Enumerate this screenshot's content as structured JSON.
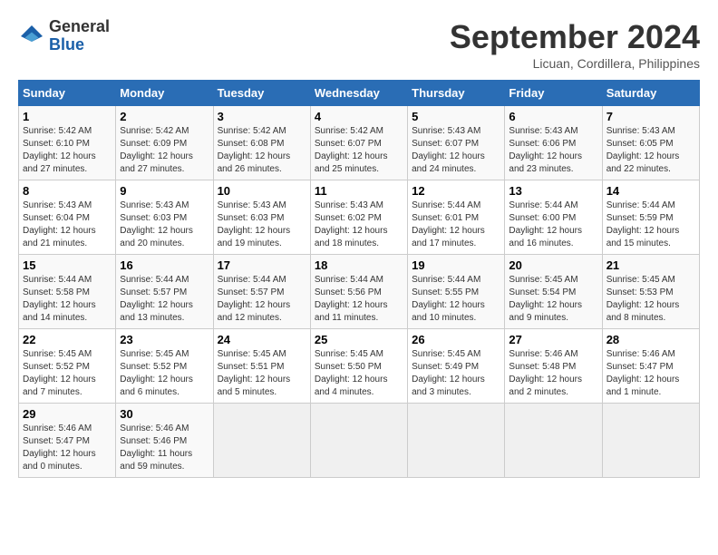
{
  "header": {
    "logo_line1": "General",
    "logo_line2": "Blue",
    "month": "September 2024",
    "location": "Licuan, Cordillera, Philippines"
  },
  "columns": [
    "Sunday",
    "Monday",
    "Tuesday",
    "Wednesday",
    "Thursday",
    "Friday",
    "Saturday"
  ],
  "weeks": [
    [
      {
        "day": "1",
        "info": "Sunrise: 5:42 AM\nSunset: 6:10 PM\nDaylight: 12 hours\nand 27 minutes."
      },
      {
        "day": "2",
        "info": "Sunrise: 5:42 AM\nSunset: 6:09 PM\nDaylight: 12 hours\nand 27 minutes."
      },
      {
        "day": "3",
        "info": "Sunrise: 5:42 AM\nSunset: 6:08 PM\nDaylight: 12 hours\nand 26 minutes."
      },
      {
        "day": "4",
        "info": "Sunrise: 5:42 AM\nSunset: 6:07 PM\nDaylight: 12 hours\nand 25 minutes."
      },
      {
        "day": "5",
        "info": "Sunrise: 5:43 AM\nSunset: 6:07 PM\nDaylight: 12 hours\nand 24 minutes."
      },
      {
        "day": "6",
        "info": "Sunrise: 5:43 AM\nSunset: 6:06 PM\nDaylight: 12 hours\nand 23 minutes."
      },
      {
        "day": "7",
        "info": "Sunrise: 5:43 AM\nSunset: 6:05 PM\nDaylight: 12 hours\nand 22 minutes."
      }
    ],
    [
      {
        "day": "8",
        "info": "Sunrise: 5:43 AM\nSunset: 6:04 PM\nDaylight: 12 hours\nand 21 minutes."
      },
      {
        "day": "9",
        "info": "Sunrise: 5:43 AM\nSunset: 6:03 PM\nDaylight: 12 hours\nand 20 minutes."
      },
      {
        "day": "10",
        "info": "Sunrise: 5:43 AM\nSunset: 6:03 PM\nDaylight: 12 hours\nand 19 minutes."
      },
      {
        "day": "11",
        "info": "Sunrise: 5:43 AM\nSunset: 6:02 PM\nDaylight: 12 hours\nand 18 minutes."
      },
      {
        "day": "12",
        "info": "Sunrise: 5:44 AM\nSunset: 6:01 PM\nDaylight: 12 hours\nand 17 minutes."
      },
      {
        "day": "13",
        "info": "Sunrise: 5:44 AM\nSunset: 6:00 PM\nDaylight: 12 hours\nand 16 minutes."
      },
      {
        "day": "14",
        "info": "Sunrise: 5:44 AM\nSunset: 5:59 PM\nDaylight: 12 hours\nand 15 minutes."
      }
    ],
    [
      {
        "day": "15",
        "info": "Sunrise: 5:44 AM\nSunset: 5:58 PM\nDaylight: 12 hours\nand 14 minutes."
      },
      {
        "day": "16",
        "info": "Sunrise: 5:44 AM\nSunset: 5:57 PM\nDaylight: 12 hours\nand 13 minutes."
      },
      {
        "day": "17",
        "info": "Sunrise: 5:44 AM\nSunset: 5:57 PM\nDaylight: 12 hours\nand 12 minutes."
      },
      {
        "day": "18",
        "info": "Sunrise: 5:44 AM\nSunset: 5:56 PM\nDaylight: 12 hours\nand 11 minutes."
      },
      {
        "day": "19",
        "info": "Sunrise: 5:44 AM\nSunset: 5:55 PM\nDaylight: 12 hours\nand 10 minutes."
      },
      {
        "day": "20",
        "info": "Sunrise: 5:45 AM\nSunset: 5:54 PM\nDaylight: 12 hours\nand 9 minutes."
      },
      {
        "day": "21",
        "info": "Sunrise: 5:45 AM\nSunset: 5:53 PM\nDaylight: 12 hours\nand 8 minutes."
      }
    ],
    [
      {
        "day": "22",
        "info": "Sunrise: 5:45 AM\nSunset: 5:52 PM\nDaylight: 12 hours\nand 7 minutes."
      },
      {
        "day": "23",
        "info": "Sunrise: 5:45 AM\nSunset: 5:52 PM\nDaylight: 12 hours\nand 6 minutes."
      },
      {
        "day": "24",
        "info": "Sunrise: 5:45 AM\nSunset: 5:51 PM\nDaylight: 12 hours\nand 5 minutes."
      },
      {
        "day": "25",
        "info": "Sunrise: 5:45 AM\nSunset: 5:50 PM\nDaylight: 12 hours\nand 4 minutes."
      },
      {
        "day": "26",
        "info": "Sunrise: 5:45 AM\nSunset: 5:49 PM\nDaylight: 12 hours\nand 3 minutes."
      },
      {
        "day": "27",
        "info": "Sunrise: 5:46 AM\nSunset: 5:48 PM\nDaylight: 12 hours\nand 2 minutes."
      },
      {
        "day": "28",
        "info": "Sunrise: 5:46 AM\nSunset: 5:47 PM\nDaylight: 12 hours\nand 1 minute."
      }
    ],
    [
      {
        "day": "29",
        "info": "Sunrise: 5:46 AM\nSunset: 5:47 PM\nDaylight: 12 hours\nand 0 minutes."
      },
      {
        "day": "30",
        "info": "Sunrise: 5:46 AM\nSunset: 5:46 PM\nDaylight: 11 hours\nand 59 minutes."
      },
      {
        "day": "",
        "info": ""
      },
      {
        "day": "",
        "info": ""
      },
      {
        "day": "",
        "info": ""
      },
      {
        "day": "",
        "info": ""
      },
      {
        "day": "",
        "info": ""
      }
    ]
  ]
}
